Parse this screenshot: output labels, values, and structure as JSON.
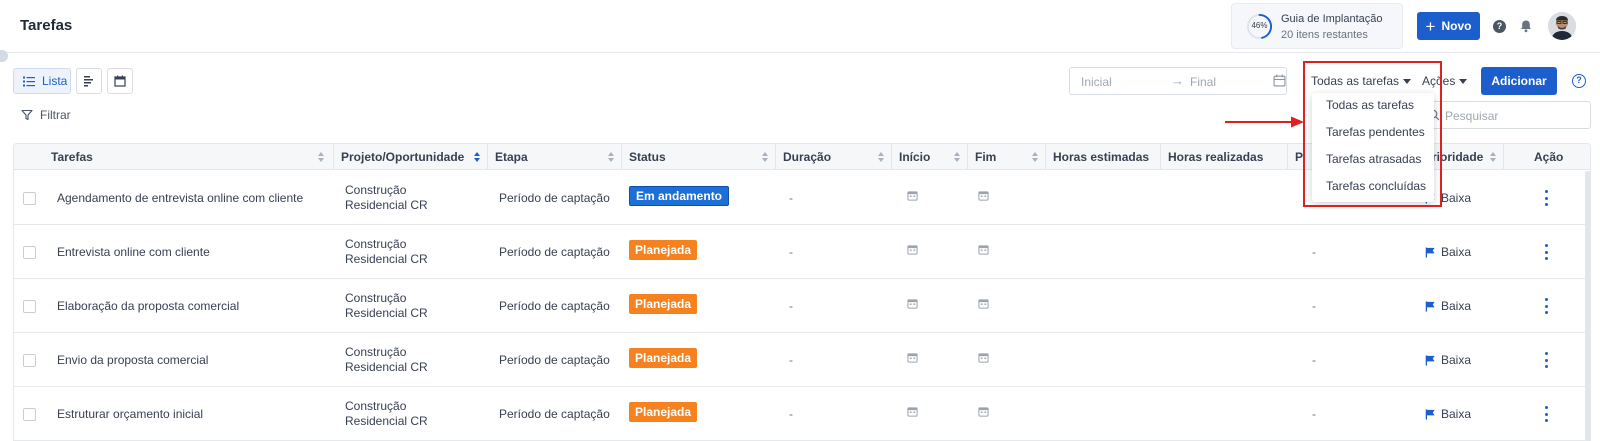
{
  "header": {
    "title": "Tarefas",
    "guide": {
      "percent": "46%",
      "progress": 0.46,
      "title": "Guia de Implantação",
      "subtitle": "20 itens restantes"
    },
    "new_button": "Novo",
    "help_icon": "question-icon",
    "bell_icon": "bell-icon"
  },
  "toolbar": {
    "view_list_label": "Lista",
    "filter_label": "Filtrar",
    "date_start_placeholder": "Inicial",
    "date_end_placeholder": "Final",
    "task_filter_label": "Todas as tarefas",
    "actions_label": "Ações",
    "add_button": "Adicionar",
    "search_placeholder": "Pesquisar"
  },
  "dropdown": {
    "items": [
      "Todas as tarefas",
      "Tarefas pendentes",
      "Tarefas atrasadas",
      "Tarefas concluídas"
    ]
  },
  "table": {
    "columns": [
      "Tarefas",
      "Projeto/Oportunidade",
      "Etapa",
      "Status",
      "Duração",
      "Início",
      "Fim",
      "Horas estimadas",
      "Horas realizadas",
      "P",
      "rioridade",
      "Ação"
    ],
    "rows": [
      {
        "task": "Agendamento de entrevista online com cliente",
        "project_line1": "Construção",
        "project_line2": "Residencial CR",
        "stage": "Período de captação",
        "status": "Em andamento",
        "duration": "-",
        "p": "",
        "priority": "Baixa"
      },
      {
        "task": "Entrevista online com cliente",
        "project_line1": "Construção",
        "project_line2": "Residencial CR",
        "stage": "Período de captação",
        "status": "Planejada",
        "duration": "-",
        "p": "-",
        "priority": "Baixa"
      },
      {
        "task": "Elaboração da proposta comercial",
        "project_line1": "Construção",
        "project_line2": "Residencial CR",
        "stage": "Período de captação",
        "status": "Planejada",
        "duration": "-",
        "p": "-",
        "priority": "Baixa"
      },
      {
        "task": "Envio da proposta comercial",
        "project_line1": "Construção",
        "project_line2": "Residencial CR",
        "stage": "Período de captação",
        "status": "Planejada",
        "duration": "-",
        "p": "-",
        "priority": "Baixa"
      },
      {
        "task": "Estruturar orçamento inicial",
        "project_line1": "Construção",
        "project_line2": "Residencial CR",
        "stage": "Período de captação",
        "status": "Planejada",
        "duration": "-",
        "p": "-",
        "priority": "Baixa"
      }
    ]
  },
  "colors": {
    "primary": "#1c5fcc",
    "status_in_progress": "#1c6fd6",
    "status_planned": "#f5821f",
    "annotation": "#e02020"
  }
}
